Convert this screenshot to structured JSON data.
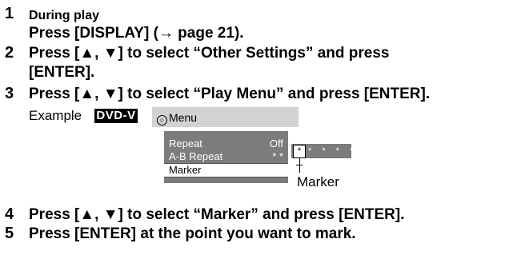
{
  "steps": [
    {
      "number": "1",
      "lines": [
        "During play",
        "Press [DISPLAY] (→ page 21)."
      ]
    },
    {
      "number": "2",
      "lines": [
        "Press  [▲, ▼]  to  select  “Other  Settings”  and  press",
        "[ENTER]."
      ]
    },
    {
      "number": "3",
      "lines": [
        "Press [▲, ▼] to select “Play Menu” and press [ENTER]."
      ]
    },
    {
      "number": "4",
      "lines": [
        "Press [▲, ▼] to select “Marker” and press [ENTER]."
      ]
    },
    {
      "number": "5",
      "lines": [
        "Press [ENTER] at the point you want to mark."
      ]
    }
  ],
  "example": {
    "label": "Example",
    "badge": "DVD-V",
    "menu_title": "Menu",
    "menu_icon": "menu-icon",
    "rows": [
      {
        "label": "Repeat",
        "value": "Off",
        "selected": false
      },
      {
        "label": "A-B Repeat",
        "value": "* *",
        "selected": false
      },
      {
        "label": "Marker",
        "value": "",
        "selected": true
      }
    ],
    "markers": {
      "first": "*",
      "rest": "* * * *"
    },
    "callout": "Marker"
  },
  "colors": {
    "panel": "#7c7c7c",
    "title_bar": "#d2d2d2",
    "badge": "#000000"
  }
}
